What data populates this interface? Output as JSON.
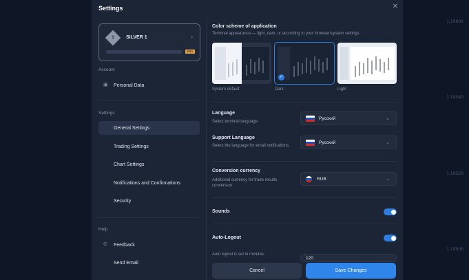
{
  "background": {
    "price_labels": [
      "1.19600",
      "1.19540",
      "1.19520",
      "1.19500"
    ]
  },
  "modal": {
    "title": "Settings",
    "close_icon": "close-icon"
  },
  "account_level": {
    "badge_number": "1",
    "name": "SILVER 1",
    "badge_text": "PRO"
  },
  "sidebar": {
    "account_header": "Account",
    "account_items": [
      {
        "label": "Personal Data",
        "icon": "id-card-icon"
      }
    ],
    "settings_header": "Settings",
    "settings_items": [
      {
        "label": "General Settings",
        "active": true
      },
      {
        "label": "Trading Settings"
      },
      {
        "label": "Chart Settings"
      },
      {
        "label": "Notifications and Confirmations"
      },
      {
        "label": "Security"
      }
    ],
    "help_header": "Help",
    "help_items": [
      {
        "label": "Feedback",
        "icon": "phone-icon"
      },
      {
        "label": "Send Email"
      }
    ]
  },
  "color_scheme": {
    "title": "Color scheme of application",
    "subtitle": "Terminal appearance — light, dark, or according to your browser/system settings",
    "options": [
      "System default",
      "Dark",
      "Light"
    ],
    "selected": "Dark"
  },
  "language": {
    "title": "Language",
    "subtitle": "Select terminal language",
    "value": "Русский"
  },
  "support_language": {
    "title": "Support Language",
    "subtitle": "Select the language for email notifications",
    "value": "Русский"
  },
  "conversion_currency": {
    "title": "Conversion currency",
    "subtitle": "Additional currency for trade results conversion",
    "value": "RUB"
  },
  "sounds": {
    "title": "Sounds",
    "enabled": true
  },
  "auto_logout": {
    "title": "Auto-Logout",
    "enabled": true,
    "subtitle": "Auto logout is set in minutes.",
    "value": "120"
  },
  "buttons": {
    "cancel": "Cancel",
    "save": "Save Changes"
  },
  "colors": {
    "accent": "#2f7de1",
    "modal_bg": "#1c2535",
    "badge": "#e6a04b"
  }
}
